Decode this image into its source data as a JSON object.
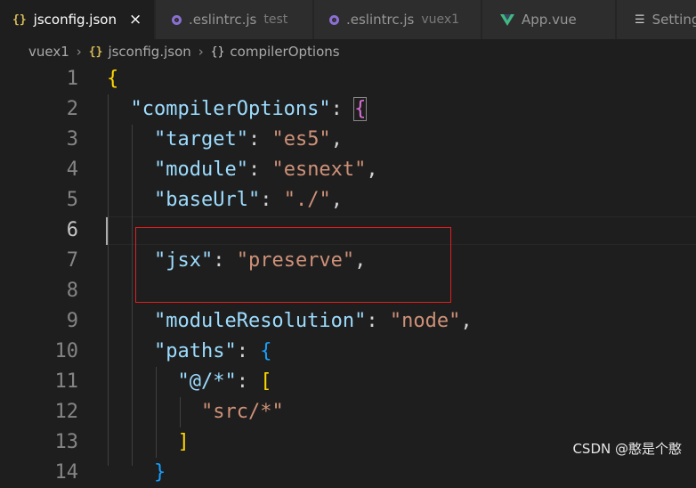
{
  "tabs": [
    {
      "label": "jsconfig.json",
      "icon": "braces-icon",
      "active": true,
      "close": "×"
    },
    {
      "label": ".eslintrc.js",
      "sub": "test",
      "icon": "eslint-icon"
    },
    {
      "label": ".eslintrc.js",
      "sub": "vuex1",
      "icon": "eslint-icon"
    },
    {
      "label": "App.vue",
      "icon": "vue-icon"
    },
    {
      "label": "Setting",
      "icon": "settings-icon"
    }
  ],
  "breadcrumb": [
    "vuex1",
    "jsconfig.json",
    "compilerOptions"
  ],
  "editor": {
    "line_numbers": [
      "1",
      "2",
      "3",
      "4",
      "5",
      "6",
      "7",
      "8",
      "9",
      "10",
      "11",
      "12",
      "13",
      "14"
    ],
    "lines": [
      {
        "t1": "{"
      },
      {
        "indent": "  ",
        "k": "\"compilerOptions\"",
        "p": ": ",
        "b": "{"
      },
      {
        "indent": "    ",
        "k": "\"target\"",
        "p": ": ",
        "s": "\"es5\"",
        "e": ","
      },
      {
        "indent": "    ",
        "k": "\"module\"",
        "p": ": ",
        "s": "\"esnext\"",
        "e": ","
      },
      {
        "indent": "    ",
        "k": "\"baseUrl\"",
        "p": ": ",
        "s": "\"./\"",
        "e": ","
      },
      {},
      {
        "indent": "    ",
        "k": "\"jsx\"",
        "p": ": ",
        "s": "\"preserve\"",
        "e": ","
      },
      {},
      {
        "indent": "    ",
        "k": "\"moduleResolution\"",
        "p": ": ",
        "s": "\"node\"",
        "e": ","
      },
      {
        "indent": "    ",
        "k": "\"paths\"",
        "p": ": ",
        "b": "{"
      },
      {
        "indent": "      ",
        "k": "\"@/*\"",
        "p": ": ",
        "b": "["
      },
      {
        "indent": "        ",
        "s": "\"src/*\""
      },
      {
        "indent": "      ",
        "b": "]"
      },
      {
        "indent": "    ",
        "b": "}"
      }
    ],
    "current_line": 6
  },
  "watermark": "CSDN @憨是个憨",
  "colors": {
    "key": "#9cdcfe",
    "string": "#ce9178",
    "bracket1": "#ffd700",
    "bracket2": "#da70d6",
    "bracket3": "#179fff",
    "highlight_box": "#e01e1e"
  }
}
